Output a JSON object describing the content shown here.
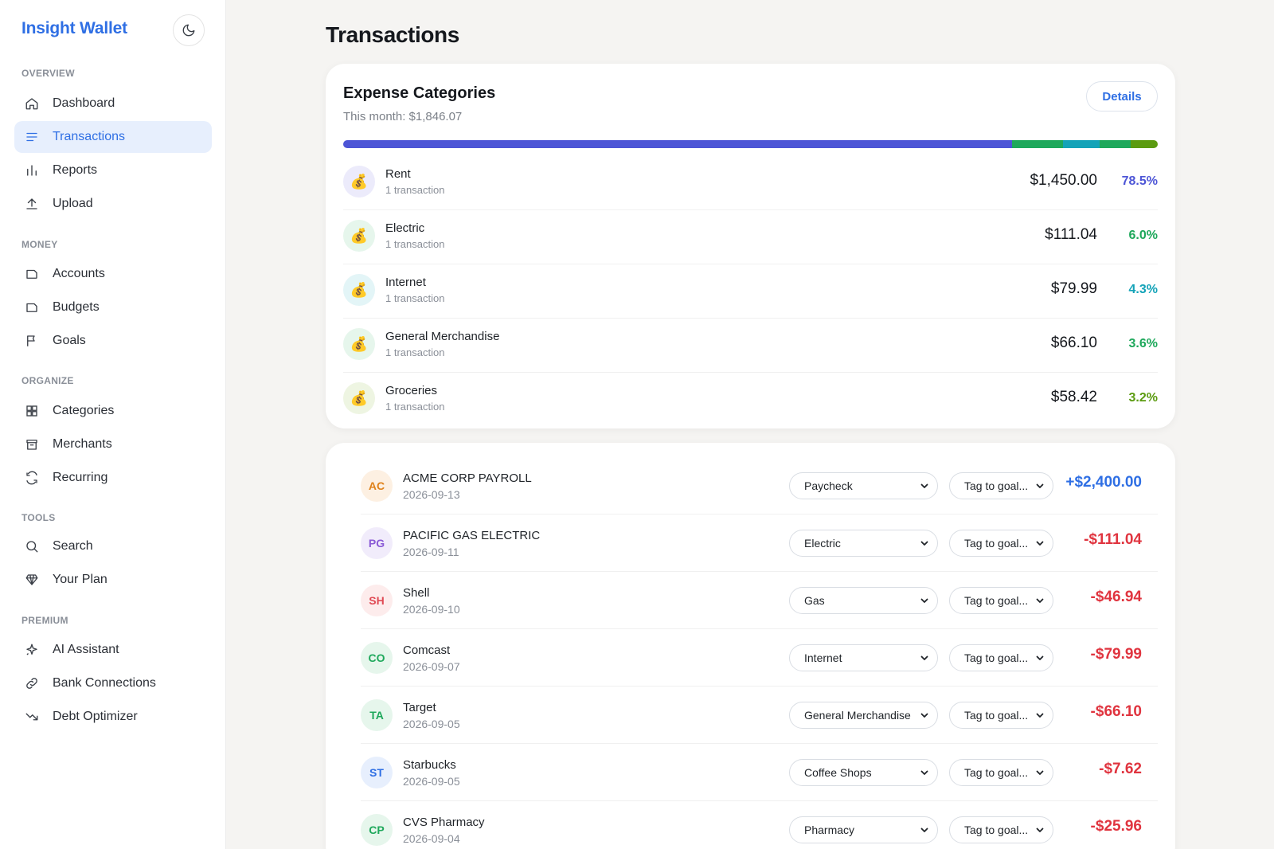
{
  "brand": "Insight Wallet",
  "sidebar": {
    "sections": [
      {
        "label": "OVERVIEW",
        "items": [
          {
            "label": "Dashboard",
            "icon": "home-icon"
          },
          {
            "label": "Transactions",
            "icon": "list-icon",
            "active": true
          },
          {
            "label": "Reports",
            "icon": "bar-chart-icon"
          },
          {
            "label": "Upload",
            "icon": "upload-icon"
          }
        ]
      },
      {
        "label": "MONEY",
        "items": [
          {
            "label": "Accounts",
            "icon": "wallet-icon"
          },
          {
            "label": "Budgets",
            "icon": "wallet-icon"
          },
          {
            "label": "Goals",
            "icon": "flag-icon"
          }
        ]
      },
      {
        "label": "ORGANIZE",
        "items": [
          {
            "label": "Categories",
            "icon": "grid-icon"
          },
          {
            "label": "Merchants",
            "icon": "store-icon"
          },
          {
            "label": "Recurring",
            "icon": "refresh-icon"
          }
        ]
      },
      {
        "label": "TOOLS",
        "items": [
          {
            "label": "Search",
            "icon": "search-icon"
          },
          {
            "label": "Your Plan",
            "icon": "diamond-icon"
          }
        ]
      },
      {
        "label": "PREMIUM",
        "items": [
          {
            "label": "AI Assistant",
            "icon": "sparkle-icon"
          },
          {
            "label": "Bank Connections",
            "icon": "link-icon"
          },
          {
            "label": "Debt Optimizer",
            "icon": "trend-down-icon"
          }
        ]
      }
    ]
  },
  "page": {
    "title": "Transactions"
  },
  "expense": {
    "title": "Expense Categories",
    "subtitle": "This month: $1,846.07",
    "details_label": "Details",
    "categories": [
      {
        "name": "Rent",
        "count": "1 transaction",
        "amount": "$1,450.00",
        "percent": "78.5%",
        "share": 78.5,
        "color": "#4d55d6",
        "icon_bg": "#ecebfb"
      },
      {
        "name": "Electric",
        "count": "1 transaction",
        "amount": "$111.04",
        "percent": "6.0%",
        "share": 6.0,
        "color": "#1ea85b",
        "icon_bg": "#e6f6ec"
      },
      {
        "name": "Internet",
        "count": "1 transaction",
        "amount": "$79.99",
        "percent": "4.3%",
        "share": 4.3,
        "color": "#14a3b8",
        "icon_bg": "#e3f5f7"
      },
      {
        "name": "General Merchandise",
        "count": "1 transaction",
        "amount": "$66.10",
        "percent": "3.6%",
        "share": 3.6,
        "color": "#1ea85b",
        "icon_bg": "#e6f6ec"
      },
      {
        "name": "Groceries",
        "count": "1 transaction",
        "amount": "$58.42",
        "percent": "3.2%",
        "share": 3.2,
        "color": "#5b9b10",
        "icon_bg": "#eef5e2"
      }
    ]
  },
  "transactions": {
    "goal_placeholder": "Tag to goal...",
    "rows": [
      {
        "initials": "AC",
        "merchant": "ACME CORP PAYROLL",
        "date": "2026-09-13",
        "category": "Paycheck",
        "amount": "+$2,400.00",
        "amount_color": "#2f6fe4",
        "avatar_bg": "#fdf0e2",
        "avatar_fg": "#e0821a"
      },
      {
        "initials": "PG",
        "merchant": "PACIFIC GAS ELECTRIC",
        "date": "2026-09-11",
        "category": "Electric",
        "amount": "-$111.04",
        "amount_color": "#e0343f",
        "avatar_bg": "#f1ecfb",
        "avatar_fg": "#8a5ad6"
      },
      {
        "initials": "SH",
        "merchant": "Shell",
        "date": "2026-09-10",
        "category": "Gas",
        "amount": "-$46.94",
        "amount_color": "#e0343f",
        "avatar_bg": "#fdecec",
        "avatar_fg": "#e04a54"
      },
      {
        "initials": "CO",
        "merchant": "Comcast",
        "date": "2026-09-07",
        "category": "Internet",
        "amount": "-$79.99",
        "amount_color": "#e0343f",
        "avatar_bg": "#e6f6ec",
        "avatar_fg": "#1ea85b"
      },
      {
        "initials": "TA",
        "merchant": "Target",
        "date": "2026-09-05",
        "category": "General Merchandise",
        "amount": "-$66.10",
        "amount_color": "#e0343f",
        "avatar_bg": "#e6f6ec",
        "avatar_fg": "#1ea85b"
      },
      {
        "initials": "ST",
        "merchant": "Starbucks",
        "date": "2026-09-05",
        "category": "Coffee Shops",
        "amount": "-$7.62",
        "amount_color": "#e0343f",
        "avatar_bg": "#e7effd",
        "avatar_fg": "#2f6fe4"
      },
      {
        "initials": "CP",
        "merchant": "CVS Pharmacy",
        "date": "2026-09-04",
        "category": "Pharmacy",
        "amount": "-$25.96",
        "amount_color": "#e0343f",
        "avatar_bg": "#e6f6ec",
        "avatar_fg": "#1ea85b"
      }
    ]
  }
}
